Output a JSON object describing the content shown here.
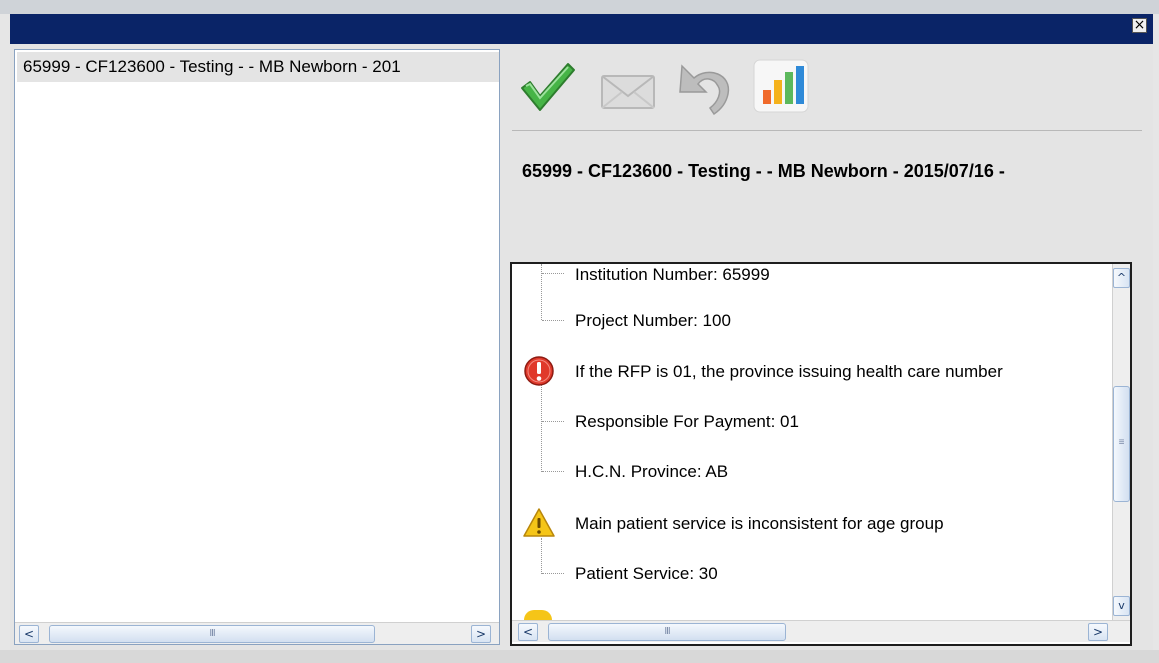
{
  "window": {
    "close_label": "×"
  },
  "left_panel": {
    "items": [
      {
        "label": "65999 - CF123600 - Testing  -  - MB Newborn - 201"
      }
    ],
    "hscroll": {
      "left": "<",
      "right": ">",
      "grip": "III"
    }
  },
  "toolbar": {
    "buttons": [
      {
        "name": "approve",
        "icon": "checkmark-icon"
      },
      {
        "name": "email",
        "icon": "envelope-icon"
      },
      {
        "name": "undo",
        "icon": "undo-arrow-icon"
      },
      {
        "name": "report",
        "icon": "bar-chart-icon"
      }
    ]
  },
  "record_title": "65999 - CF123600 - Testing  -  - MB Newborn - 2015/07/16 -",
  "tree": {
    "rows": [
      {
        "text": "Institution Number: 65999",
        "kind": "child"
      },
      {
        "text": "Project Number: 100",
        "kind": "child"
      },
      {
        "text": "If the RFP is 01, the province issuing health care number",
        "kind": "error"
      },
      {
        "text": "Responsible For Payment: 01",
        "kind": "child"
      },
      {
        "text": "H.C.N. Province: AB",
        "kind": "child"
      },
      {
        "text": "Main patient service is inconsistent for age group",
        "kind": "warning"
      },
      {
        "text": "Patient Service: 30",
        "kind": "child"
      }
    ],
    "vscroll": {
      "up": "^",
      "down": "v",
      "grip": "≡"
    },
    "hscroll": {
      "left": "<",
      "right": ">",
      "grip": "III"
    }
  },
  "colors": {
    "titlebar": "#0a2467",
    "error": "#e0392b",
    "warning": "#f5c518",
    "check": "#3aa83a"
  }
}
